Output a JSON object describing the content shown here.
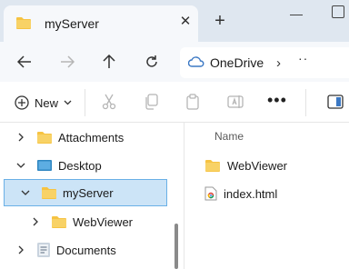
{
  "window": {
    "tab_title": "myServer",
    "close_glyph": "✕",
    "new_tab_glyph": "+"
  },
  "navigation": {
    "address_location": "OneDrive",
    "address_chevron": "›",
    "address_more": "··"
  },
  "toolbar": {
    "new_label": "New",
    "more_glyph": "•••"
  },
  "tree": {
    "items": [
      {
        "label": "Attachments",
        "icon": "folder-icon",
        "state": "collapsed"
      },
      {
        "label": "Desktop",
        "icon": "desktop-icon",
        "state": "expanded"
      },
      {
        "label": "myServer",
        "icon": "folder-icon",
        "state": "expanded",
        "selected": true
      },
      {
        "label": "WebViewer",
        "icon": "folder-icon",
        "state": "collapsed"
      },
      {
        "label": "Documents",
        "icon": "documents-icon",
        "state": "collapsed"
      }
    ]
  },
  "content": {
    "column_name": "Name",
    "files": [
      {
        "name": "WebViewer",
        "icon": "folder-icon"
      },
      {
        "name": "index.html",
        "icon": "chrome-html-icon"
      }
    ]
  },
  "colors": {
    "selection_bg": "#cce4f7",
    "selection_border": "#6ab0e6",
    "folder": "#f6c342",
    "onedrive": "#3b78c4"
  }
}
